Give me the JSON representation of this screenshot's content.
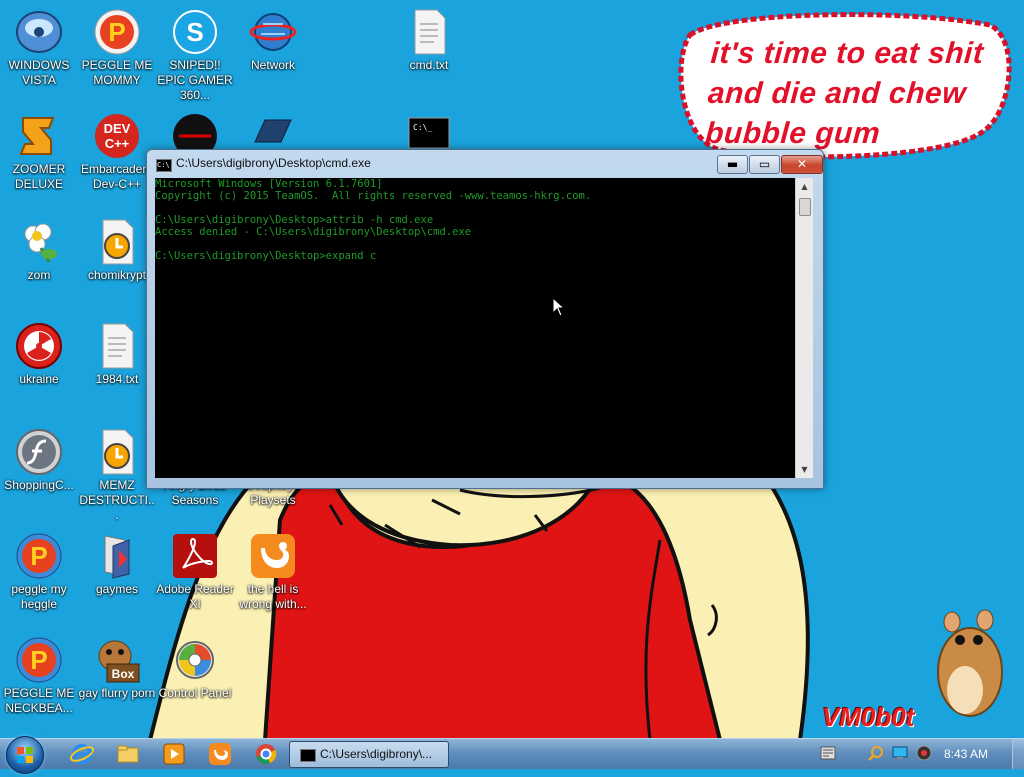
{
  "desktop": {
    "icons": [
      {
        "label": "WINDOWS VISTA",
        "icon": "windows-vista-disc-icon"
      },
      {
        "label": "PEGGLE ME MOMMY",
        "icon": "peggle-icon"
      },
      {
        "label": "SNIPED!! EPIC GAMER 360...",
        "icon": "skype-icon"
      },
      {
        "label": "Network",
        "icon": "network-icon"
      },
      {
        "label": "cmd.txt",
        "icon": "text-file-icon"
      },
      {
        "label": "ZOOMER DELUXE",
        "icon": "zoomer-deluxe-icon"
      },
      {
        "label": "Embarcadero Dev-C++",
        "icon": "devcpp-icon"
      },
      {
        "label": "zom",
        "icon": "flower-icon"
      },
      {
        "label": "chomikrypt",
        "icon": "clock-file-icon"
      },
      {
        "label": "ukraine",
        "icon": "radiation-icon"
      },
      {
        "label": "1984.txt",
        "icon": "text-file-icon"
      },
      {
        "label": "ShoppingC...",
        "icon": "flash-icon"
      },
      {
        "label": "MEMZ DESTRUCTI...",
        "icon": "clock-file-icon"
      },
      {
        "label": "Angry Birds Seasons",
        "icon": "angry-birds-icon"
      },
      {
        "label": "Soupitoys Playsets",
        "icon": "playsets-icon"
      },
      {
        "label": "peggle my heggle",
        "icon": "peggle-icon"
      },
      {
        "label": "gaymes",
        "icon": "games-icon"
      },
      {
        "label": "Adobe Reader XI",
        "icon": "adobe-reader-icon"
      },
      {
        "label": "the hell is wrong with...",
        "icon": "uc-browser-icon"
      },
      {
        "label": "PEGGLE ME NECKBEA...",
        "icon": "peggle-icon"
      },
      {
        "label": "gay flurry porn",
        "icon": "hamster-box-icon"
      },
      {
        "label": "Control Panel",
        "icon": "control-panel-icon"
      }
    ],
    "speech_bubble": [
      "it's time to eat shit",
      "and die and chew",
      "bubble gum"
    ],
    "watermark": "VM0b0t"
  },
  "cmd_window": {
    "title": "C:\\Users\\digibrony\\Desktop\\cmd.exe",
    "lines": [
      "Microsoft Windows [Version 6.1.7601]",
      "Copyright (c) 2015 TeamOS.  All rights reserved -www.teamos-hkrg.com.",
      "",
      "C:\\Users\\digibrony\\Desktop>attrib -h cmd.exe",
      "Access denied - C:\\Users\\digibrony\\Desktop\\cmd.exe",
      "",
      "C:\\Users\\digibrony\\Desktop>expand c"
    ],
    "text_color": "#1f9a28",
    "minimize_glyph": "▬",
    "maximize_glyph": "▭",
    "close_glyph": "✕",
    "scroll_up_glyph": "▲",
    "scroll_down_glyph": "▼",
    "title_icon_text": "C:\\"
  },
  "taskbar": {
    "start_label": "Start",
    "pinned": [
      "internet-explorer-icon",
      "explorer-folder-icon",
      "media-player-icon",
      "uc-browser-icon",
      "chrome-icon"
    ],
    "active_task_label": "C:\\Users\\digibrony\\...",
    "tray_icons": [
      "action-center-icon",
      "search-icon",
      "display-icon",
      "volume-icon"
    ],
    "clock": "8:43 AM"
  }
}
